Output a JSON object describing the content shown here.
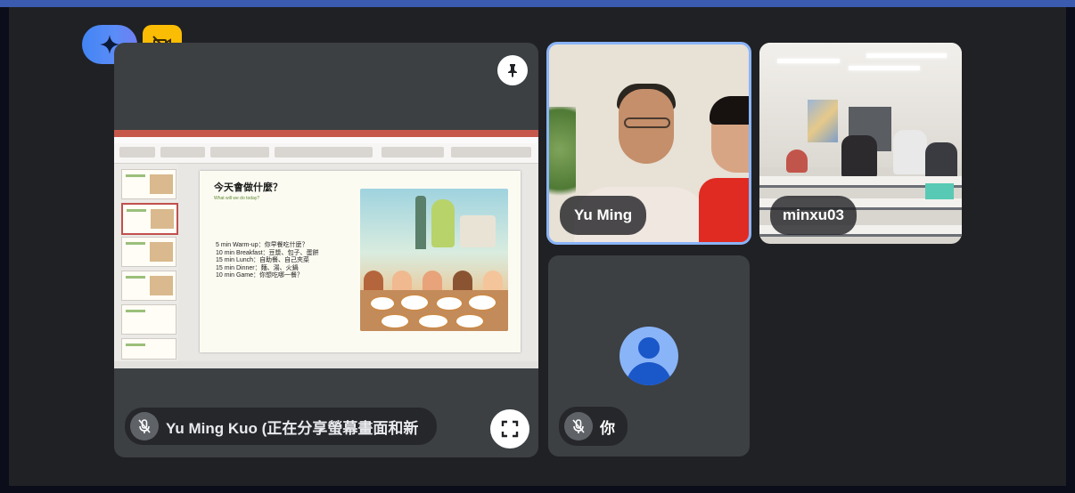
{
  "main": {
    "presenter_label": "Yu Ming Kuo (正在分享螢幕畫面和新",
    "slide": {
      "title": "今天會做什麼？",
      "subtitle": "What will we do today?",
      "agenda": [
        "5 min Warm-up：你早餐吃什麼？",
        "10 min Breakfast：豆漿、包子、蛋餅",
        "15 min Lunch：自助餐、自己夾菜",
        "15 min Dinner：麵、湯、火鍋",
        "10 min Game：你想吃哪一餐？"
      ]
    }
  },
  "participants": {
    "yu_ming": "Yu Ming",
    "minxu": "minxu03",
    "self": "你"
  },
  "colors": {
    "accent_border": "#8ab4f8",
    "tile_bg": "#3c4043",
    "stage_bg": "#202124",
    "nocam_badge": "#fbbc04",
    "gemini_badge": "#4285f4"
  },
  "icons": {
    "gemini": "sparkle-icon",
    "camera_off": "camera-off-icon",
    "pin": "pin-icon",
    "mic_off": "mic-off-icon",
    "fullscreen": "fullscreen-icon",
    "avatar": "person-icon"
  }
}
